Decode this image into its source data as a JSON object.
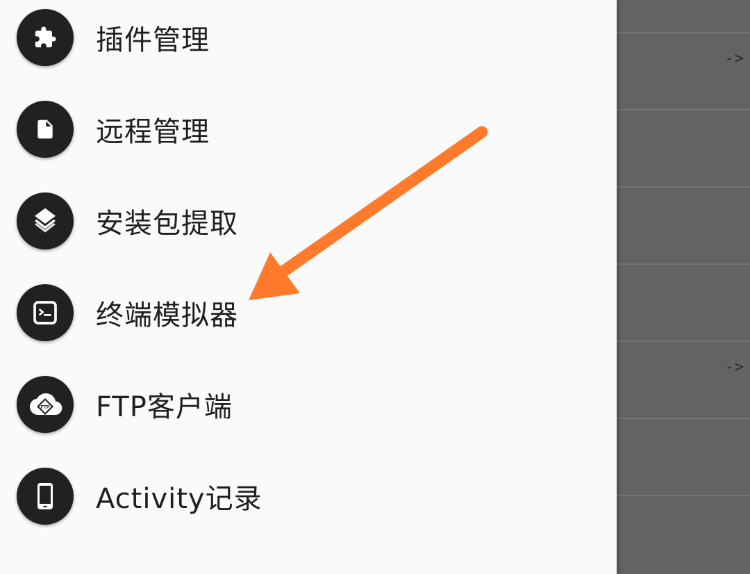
{
  "drawer": {
    "items": [
      {
        "label": "插件管理",
        "icon": "puzzle-icon"
      },
      {
        "label": "远程管理",
        "icon": "file-icon"
      },
      {
        "label": "安装包提取",
        "icon": "layers-icon"
      },
      {
        "label": "终端模拟器",
        "icon": "terminal-icon"
      },
      {
        "label": "FTP客户端",
        "icon": "ftp-cloud-icon",
        "icon_text": "FTP"
      },
      {
        "label": "Activity记录",
        "icon": "phone-icon"
      }
    ]
  },
  "background": {
    "arrows": [
      "->",
      "->"
    ]
  },
  "colors": {
    "drawer_bg": "#fafafa",
    "icon_circle": "#212121",
    "overlay": "#636363",
    "annotation_arrow": "#ff7a2a"
  }
}
